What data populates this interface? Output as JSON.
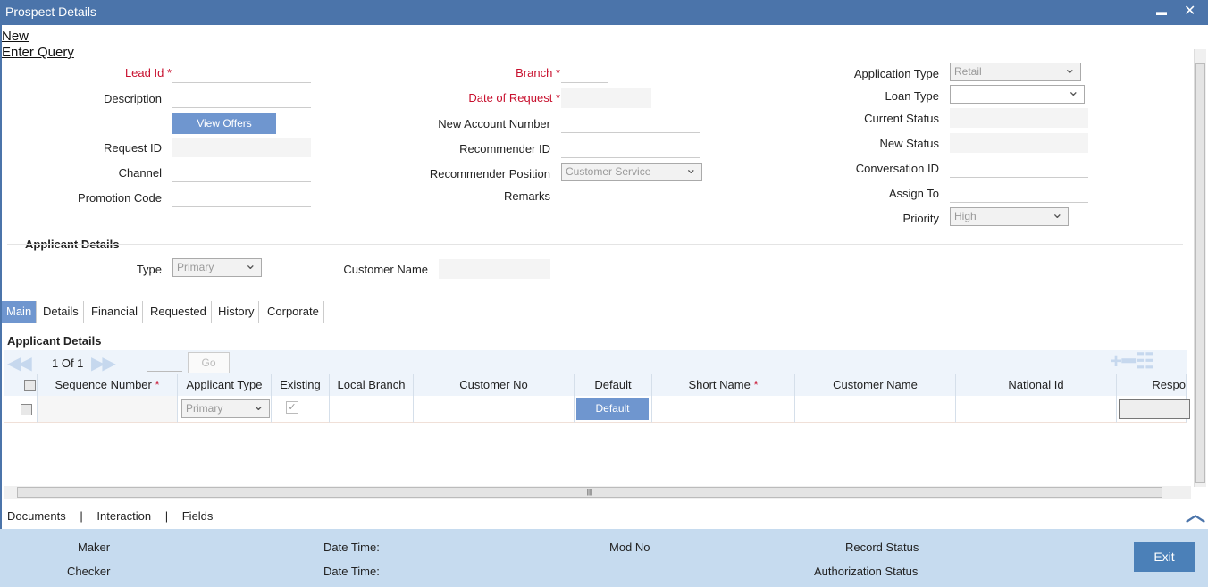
{
  "window": {
    "title": "Prospect Details",
    "minimize": "▬",
    "close": "✕"
  },
  "actions": {
    "new": "New",
    "enter_query": "Enter Query"
  },
  "form": {
    "lead_id": "Lead Id",
    "description": "Description",
    "view_offers": "View Offers",
    "request_id": "Request ID",
    "channel": "Channel",
    "promotion_code": "Promotion Code",
    "branch": "Branch",
    "date_of_request": "Date of Request",
    "new_account_number": "New Account Number",
    "recommender_id": "Recommender ID",
    "recommender_position": "Recommender Position",
    "recommender_position_value": "Customer Service",
    "remarks": "Remarks",
    "application_type": "Application Type",
    "application_type_value": "Retail",
    "loan_type": "Loan Type",
    "loan_type_value": "",
    "current_status": "Current Status",
    "new_status": "New Status",
    "conversation_id": "Conversation ID",
    "assign_to": "Assign To",
    "priority": "Priority",
    "priority_value": "High",
    "required_mark": "*"
  },
  "applicant": {
    "heading": "Applicant Details",
    "type": "Type",
    "type_value": "Primary",
    "customer_name": "Customer Name"
  },
  "tabs": [
    {
      "label": "Main",
      "active": true
    },
    {
      "label": "Details"
    },
    {
      "label": "Financial"
    },
    {
      "label": "Requested"
    },
    {
      "label": "History"
    },
    {
      "label": "Corporate"
    }
  ],
  "grid": {
    "heading": "Applicant Details",
    "page": "1 Of 1",
    "go": "Go",
    "columns": [
      "Sequence Number",
      "Applicant Type",
      "Existing",
      "Local Branch",
      "Customer No",
      "Default",
      "Short Name",
      "Customer Name",
      "National Id",
      "Respo"
    ],
    "row": {
      "applicant_type": "Primary",
      "existing": true,
      "default_button": "Default"
    }
  },
  "bottom_links": [
    "Documents",
    "Interaction",
    "Fields"
  ],
  "footer": {
    "maker": "Maker",
    "checker": "Checker",
    "date_time": "Date Time:",
    "mod_no": "Mod No",
    "record_status": "Record Status",
    "authorization_status": "Authorization Status",
    "exit": "Exit"
  }
}
